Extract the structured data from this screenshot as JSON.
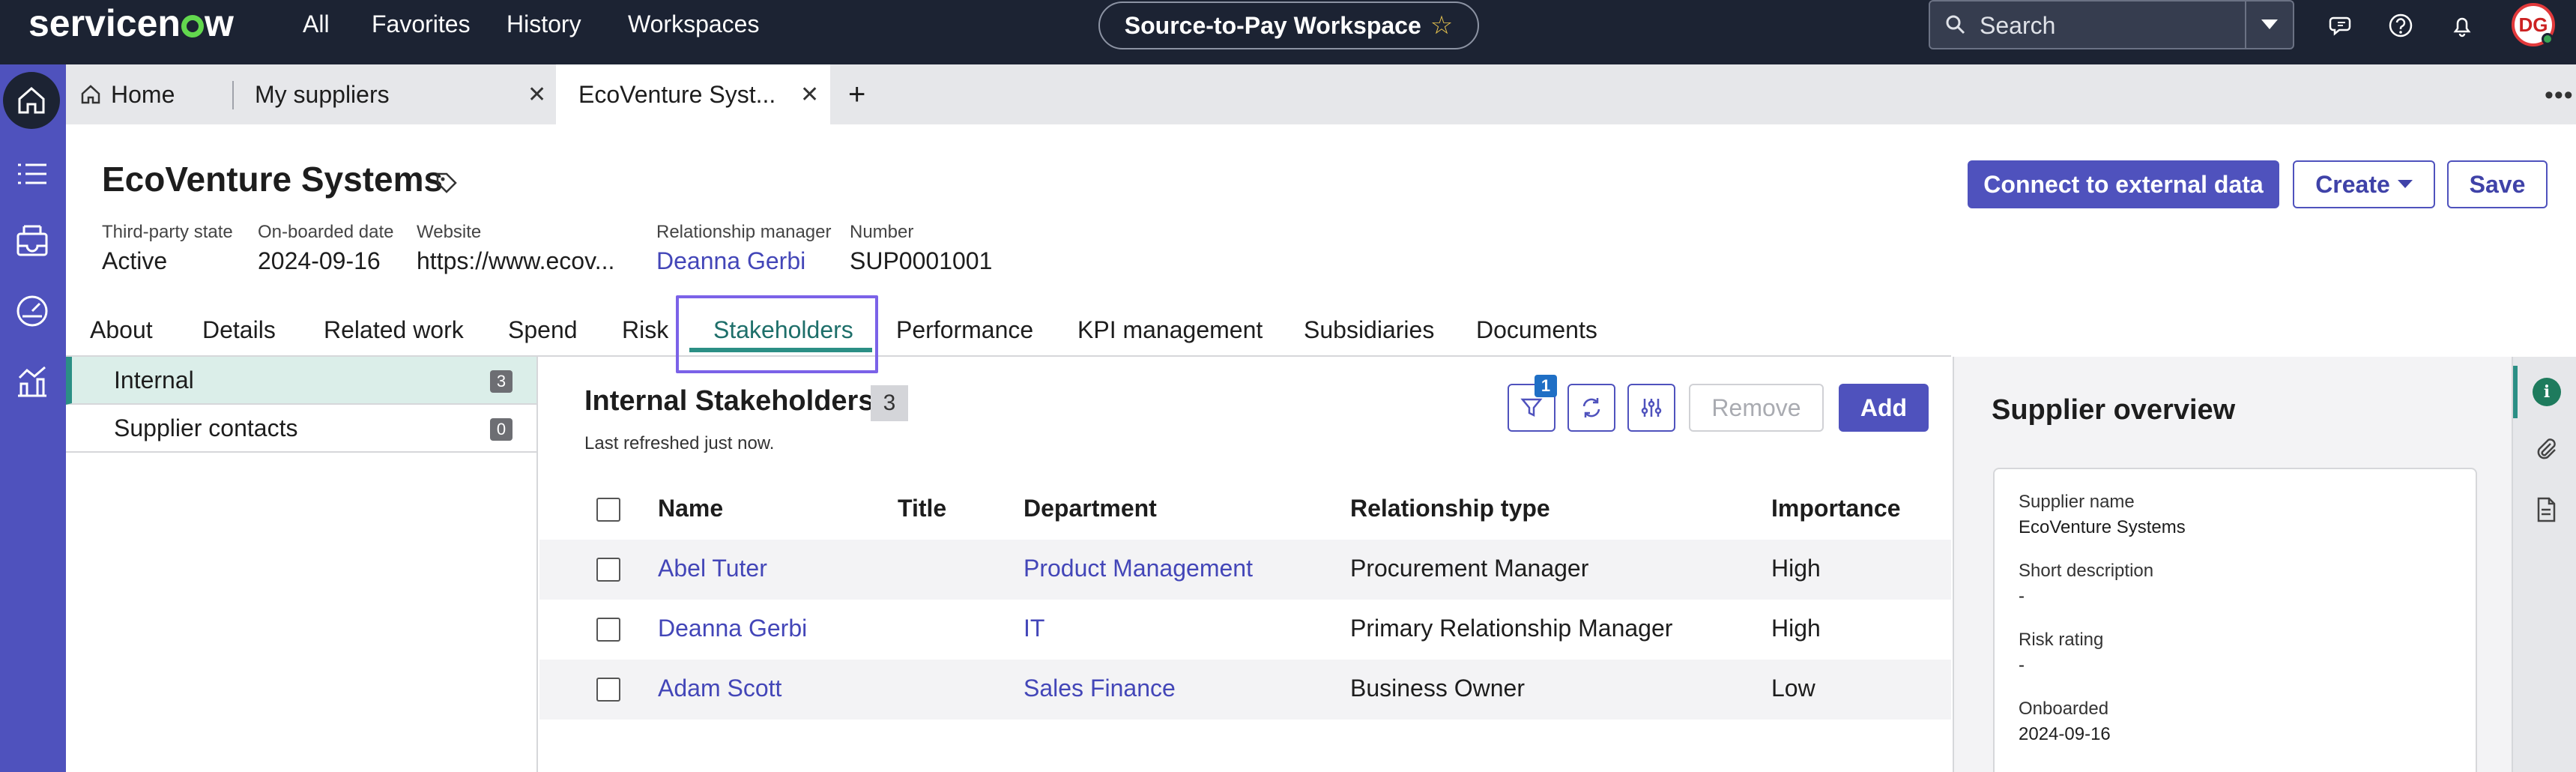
{
  "topnav": {
    "logo": "servicenow",
    "links": [
      "All",
      "Favorites",
      "History",
      "Workspaces"
    ],
    "workspace": "Source-to-Pay Workspace",
    "search_placeholder": "Search",
    "avatar_initials": "DG"
  },
  "tabs": {
    "home": "Home",
    "items": [
      "My suppliers",
      "EcoVenture Syst..."
    ],
    "add": "+"
  },
  "record": {
    "title": "EcoVenture Systems",
    "fields": [
      {
        "label": "Third-party state",
        "value": "Active"
      },
      {
        "label": "On-boarded date",
        "value": "2024-09-16"
      },
      {
        "label": "Website",
        "value": "https://www.ecov..."
      },
      {
        "label": "Relationship manager",
        "value": "Deanna Gerbi"
      },
      {
        "label": "Number",
        "value": "SUP0001001"
      }
    ],
    "actions": {
      "connect": "Connect to external data",
      "create": "Create",
      "save": "Save"
    }
  },
  "record_tabs": [
    "About",
    "Details",
    "Related work",
    "Spend",
    "Risk",
    "Stakeholders",
    "Performance",
    "KPI management",
    "Subsidiaries",
    "Documents"
  ],
  "sublist": [
    {
      "label": "Internal",
      "count": "3"
    },
    {
      "label": "Supplier contacts",
      "count": "0"
    }
  ],
  "stakeholders": {
    "title": "Internal Stakeholders",
    "count": "3",
    "refreshed": "Last refreshed just now.",
    "filter_badge": "1",
    "remove": "Remove",
    "add": "Add",
    "columns": [
      "Name",
      "Title",
      "Department",
      "Relationship type",
      "Importance"
    ],
    "rows": [
      {
        "name": "Abel Tuter",
        "title": "",
        "department": "Product Management",
        "relationship": "Procurement Manager",
        "importance": "High"
      },
      {
        "name": "Deanna Gerbi",
        "title": "",
        "department": "IT",
        "relationship": "Primary Relationship Manager",
        "importance": "High"
      },
      {
        "name": "Adam Scott",
        "title": "",
        "department": "Sales Finance",
        "relationship": "Business Owner",
        "importance": "Low"
      }
    ]
  },
  "overview": {
    "title": "Supplier overview",
    "fields": [
      {
        "label": "Supplier name",
        "value": "EcoVenture Systems"
      },
      {
        "label": "Short description",
        "value": "-"
      },
      {
        "label": "Risk rating",
        "value": "-"
      },
      {
        "label": "Onboarded",
        "value": "2024-09-16"
      }
    ]
  },
  "colors": {
    "accent": "#4f52bd",
    "nav": "#1c2333",
    "active_tab": "#2b8f85",
    "link": "#4346b8"
  }
}
